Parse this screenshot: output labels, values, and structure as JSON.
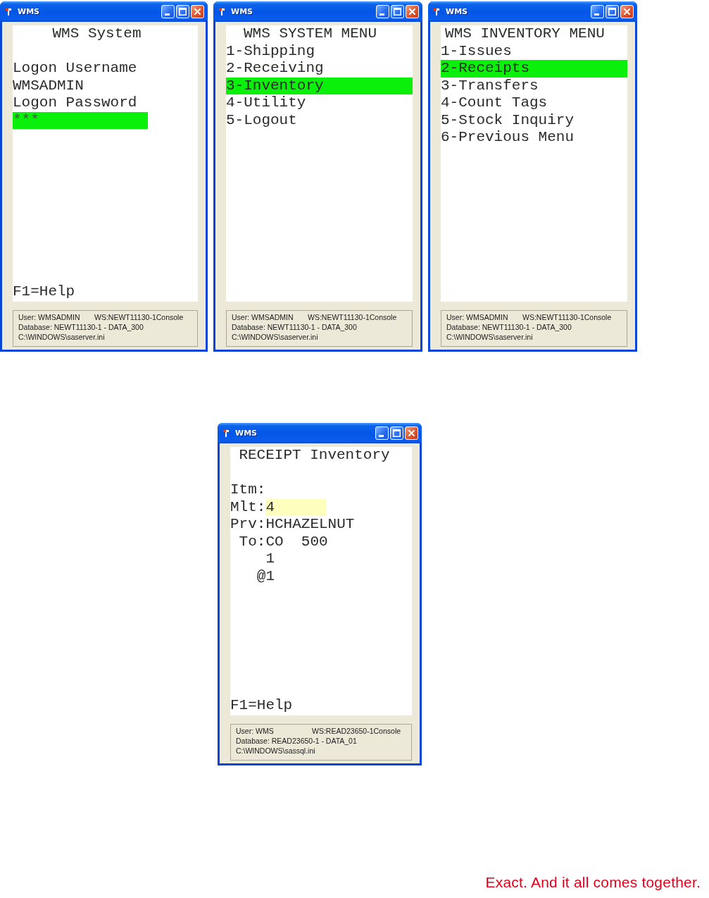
{
  "windows": [
    {
      "title": "WMS",
      "kind": "form",
      "heading": "WMS System",
      "lines": [
        {
          "kind": "text",
          "text": "Logon Username"
        },
        {
          "kind": "text",
          "text": "WMSADMIN"
        },
        {
          "kind": "text",
          "text": "Logon Password"
        },
        {
          "kind": "password",
          "value": "***",
          "focused": true
        }
      ],
      "help": "F1=Help",
      "status": {
        "user": "User: WMSADMIN",
        "workstation": "WS:NEWT11130-1Console",
        "database": "Database: NEWT11130-1 - DATA_300",
        "config_file": "C:\\WINDOWS\\saserver.ini"
      }
    },
    {
      "title": "WMS",
      "kind": "menu",
      "heading": "WMS SYSTEM MENU",
      "lines": [
        {
          "kind": "menu",
          "text": "1-Shipping",
          "selected": false
        },
        {
          "kind": "menu",
          "text": "2-Receiving",
          "selected": false
        },
        {
          "kind": "menu",
          "text": "3-Inventory",
          "selected": true
        },
        {
          "kind": "menu",
          "text": "4-Utility",
          "selected": false
        },
        {
          "kind": "menu",
          "text": "5-Logout",
          "selected": false
        }
      ],
      "status": {
        "user": "User: WMSADMIN",
        "workstation": "WS:NEWT11130-1Console",
        "database": "Database: NEWT11130-1 - DATA_300",
        "config_file": "C:\\WINDOWS\\saserver.ini"
      }
    },
    {
      "title": "WMS",
      "kind": "menu",
      "heading": "WMS INVENTORY MENU",
      "lines": [
        {
          "kind": "menu",
          "text": "1-Issues",
          "selected": false
        },
        {
          "kind": "menu",
          "text": "2-Receipts",
          "selected": true
        },
        {
          "kind": "menu",
          "text": "3-Transfers",
          "selected": false
        },
        {
          "kind": "menu",
          "text": "4-Count Tags",
          "selected": false
        },
        {
          "kind": "menu",
          "text": "5-Stock Inquiry",
          "selected": false
        },
        {
          "kind": "menu",
          "text": "6-Previous Menu",
          "selected": false
        }
      ],
      "status": {
        "user": "User: WMSADMIN",
        "workstation": "WS:NEWT11130-1Console",
        "database": "Database: NEWT11130-1 - DATA_300",
        "config_file": "C:\\WINDOWS\\saserver.ini"
      }
    },
    {
      "title": "WMS",
      "kind": "form",
      "heading": "RECEIPT Inventory",
      "lines": [
        {
          "kind": "text",
          "text": "Itm:"
        },
        {
          "kind": "field",
          "label": "Mlt:",
          "value": "4",
          "focused": true
        },
        {
          "kind": "text",
          "text": "Prv:HCHAZELNUT"
        },
        {
          "kind": "text",
          "text": " To:CO  500"
        },
        {
          "kind": "text",
          "text": "    1"
        },
        {
          "kind": "text",
          "text": "   @1"
        }
      ],
      "help": "F1=Help",
      "status": {
        "user": "User: WMS",
        "workstation": "WS:READ23650-1Console",
        "database": "Database: READ23650-1 - DATA_01",
        "config_file": "C:\\WINDOWS\\sassql.ini"
      }
    }
  ],
  "tagline": "Exact. And it all comes together."
}
